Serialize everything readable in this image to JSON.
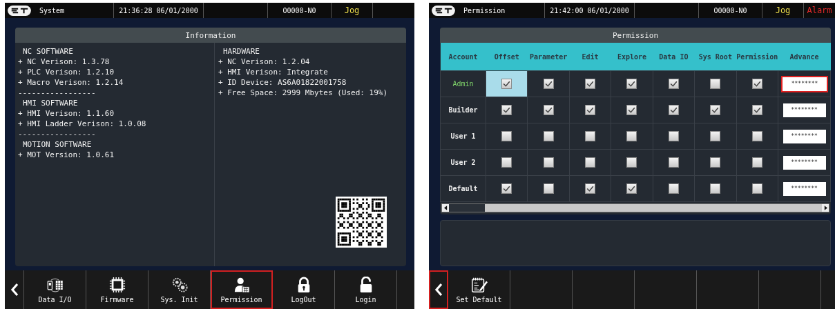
{
  "left_screen": {
    "status_bar": {
      "title": "System",
      "datetime": "21:36:28 06/01/2000",
      "program": "O0000-N0",
      "mode": "Jog"
    },
    "information": {
      "title": "Information",
      "left_lines": [
        {
          "kind": "heading",
          "text": "NC SOFTWARE"
        },
        {
          "kind": "item",
          "text": "+ NC Verison: 1.3.78"
        },
        {
          "kind": "item",
          "text": "+ PLC Verison: 1.2.10"
        },
        {
          "kind": "item",
          "text": "+ Macro Verison: 1.2.14"
        },
        {
          "kind": "item",
          "text": "-----------------"
        },
        {
          "kind": "heading",
          "text": "HMI SOFTWARE"
        },
        {
          "kind": "item",
          "text": "+ HMI Verison: 1.1.60"
        },
        {
          "kind": "item",
          "text": "+ HMI Ladder Verison: 1.0.08"
        },
        {
          "kind": "item",
          "text": "-----------------"
        },
        {
          "kind": "heading",
          "text": "MOTION SOFTWARE"
        },
        {
          "kind": "item",
          "text": "+ MOT Version: 1.0.61"
        }
      ],
      "right_lines": [
        {
          "kind": "heading",
          "text": "HARDWARE"
        },
        {
          "kind": "item",
          "text": "+ NC Verison: 1.2.04"
        },
        {
          "kind": "item",
          "text": "+ HMI Verison: Integrate"
        },
        {
          "kind": "item",
          "text": "+ ID Device: AS6A01822001758"
        },
        {
          "kind": "item",
          "text": "+ Free Space: 2999 Mbytes (Used: 19%)"
        }
      ]
    },
    "back_button": {
      "selected": false
    },
    "softkeys": [
      {
        "kind": "data-io",
        "label": "Data I/O",
        "selected": false
      },
      {
        "kind": "chip",
        "label": "Firmware",
        "selected": false
      },
      {
        "kind": "gears",
        "label": "Sys. Init",
        "selected": false
      },
      {
        "kind": "user",
        "label": "Permission",
        "selected": true
      },
      {
        "kind": "lock",
        "label": "LogOut",
        "selected": false
      },
      {
        "kind": "unlock",
        "label": "Login",
        "selected": false
      }
    ]
  },
  "right_screen": {
    "status_bar": {
      "title": "Permission",
      "datetime": "21:42:00 06/01/2000",
      "program": "O0000-N0",
      "mode": "Jog",
      "alarm": "Alarm"
    },
    "permission": {
      "title": "Permission",
      "columns": [
        "Account",
        "Offset",
        "Parameter",
        "Edit",
        "Explore",
        "Data IO",
        "Sys Root",
        "Permission",
        "Advance"
      ],
      "rows": [
        {
          "account": "Admin",
          "selected": true,
          "permissions": [
            {
              "checked": true,
              "focused": true
            },
            {
              "checked": true,
              "focused": false
            },
            {
              "checked": true,
              "focused": false
            },
            {
              "checked": true,
              "focused": false
            },
            {
              "checked": true,
              "focused": false
            },
            {
              "checked": false,
              "focused": false
            },
            {
              "checked": true,
              "focused": false
            }
          ],
          "advance": {
            "value": "********",
            "focused": true
          }
        },
        {
          "account": "Builder",
          "selected": false,
          "permissions": [
            {
              "checked": true,
              "focused": false
            },
            {
              "checked": true,
              "focused": false
            },
            {
              "checked": true,
              "focused": false
            },
            {
              "checked": true,
              "focused": false
            },
            {
              "checked": true,
              "focused": false
            },
            {
              "checked": true,
              "focused": false
            },
            {
              "checked": true,
              "focused": false
            }
          ],
          "advance": {
            "value": "********",
            "focused": false
          }
        },
        {
          "account": "User 1",
          "selected": false,
          "permissions": [
            {
              "checked": false,
              "focused": false
            },
            {
              "checked": false,
              "focused": false
            },
            {
              "checked": false,
              "focused": false
            },
            {
              "checked": false,
              "focused": false
            },
            {
              "checked": false,
              "focused": false
            },
            {
              "checked": false,
              "focused": false
            },
            {
              "checked": false,
              "focused": false
            }
          ],
          "advance": {
            "value": "********",
            "focused": false
          }
        },
        {
          "account": "User 2",
          "selected": false,
          "permissions": [
            {
              "checked": false,
              "focused": false
            },
            {
              "checked": false,
              "focused": false
            },
            {
              "checked": false,
              "focused": false
            },
            {
              "checked": false,
              "focused": false
            },
            {
              "checked": false,
              "focused": false
            },
            {
              "checked": false,
              "focused": false
            },
            {
              "checked": false,
              "focused": false
            }
          ],
          "advance": {
            "value": "********",
            "focused": false
          }
        },
        {
          "account": "Default",
          "selected": false,
          "permissions": [
            {
              "checked": true,
              "focused": false
            },
            {
              "checked": false,
              "focused": false
            },
            {
              "checked": true,
              "focused": false
            },
            {
              "checked": true,
              "focused": false
            },
            {
              "checked": false,
              "focused": false
            },
            {
              "checked": false,
              "focused": false
            },
            {
              "checked": false,
              "focused": false
            }
          ],
          "advance": {
            "value": "********",
            "focused": false
          }
        }
      ]
    },
    "back_button": {
      "selected": true
    },
    "softkeys": [
      {
        "kind": "notepad",
        "label": "Set Default",
        "selected": false
      }
    ]
  }
}
